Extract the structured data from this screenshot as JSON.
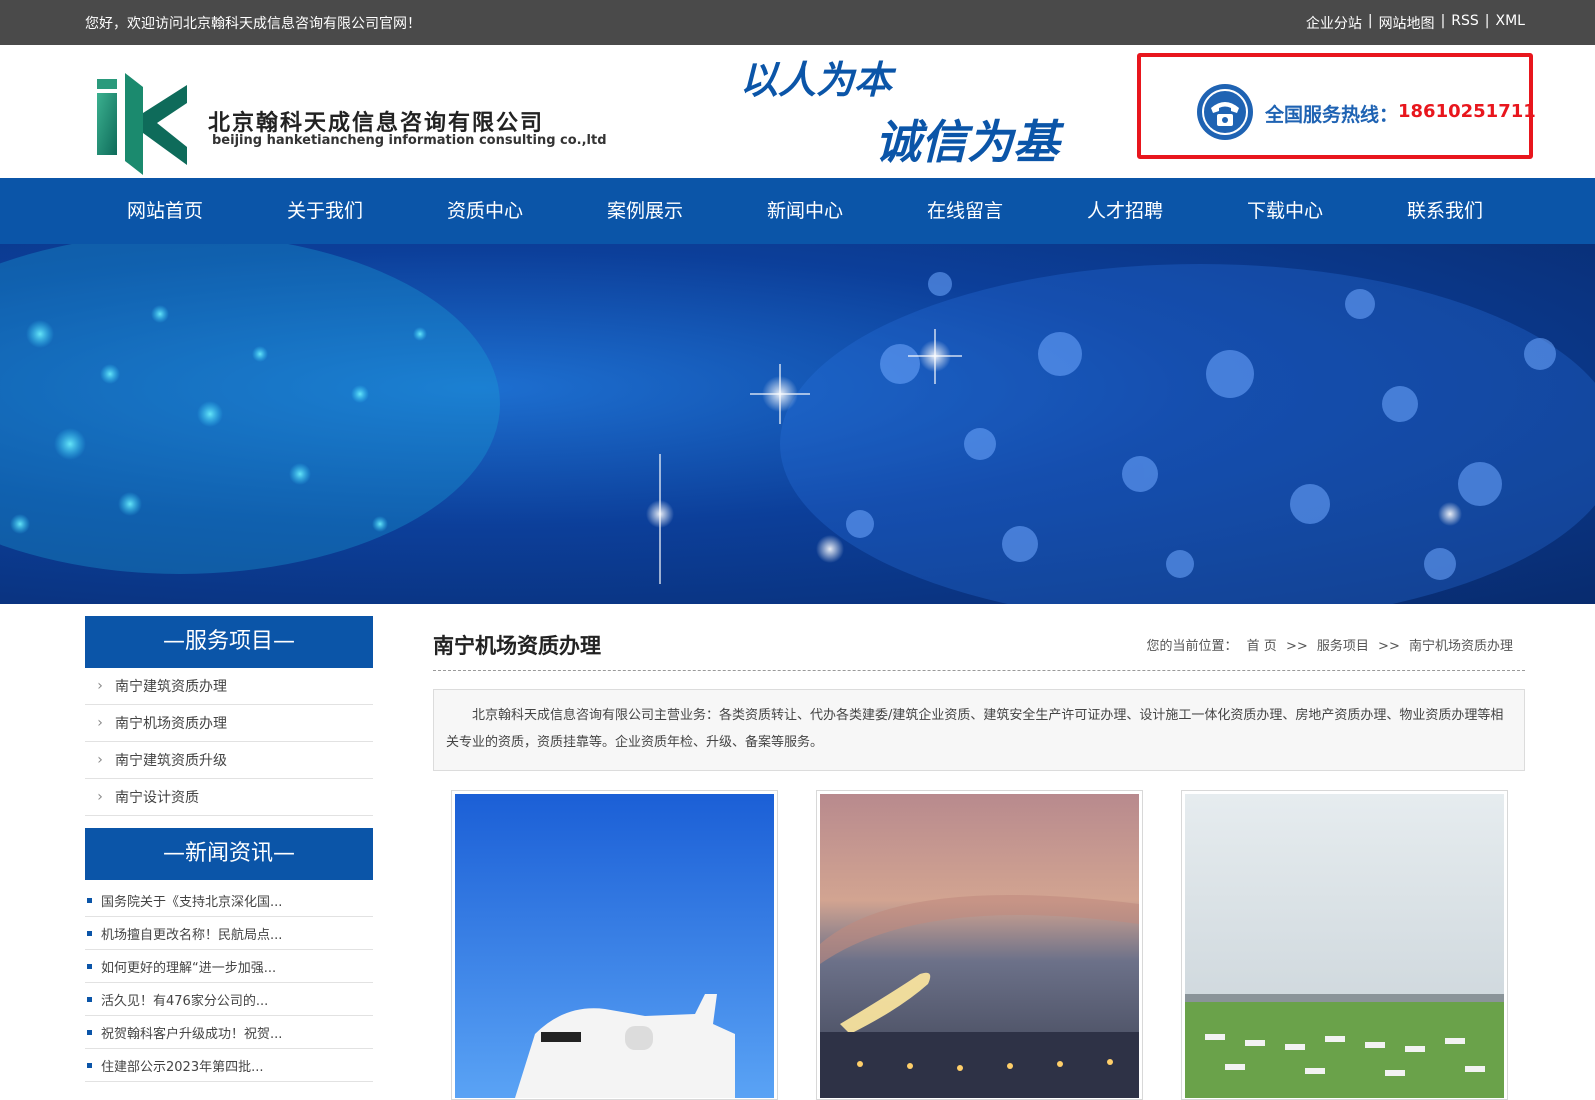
{
  "topbar": {
    "welcome": "您好，欢迎访问北京翰科天成信息咨询有限公司官网！",
    "links": [
      "企业分站",
      "网站地图",
      "RSS",
      "XML"
    ],
    "separator": "|"
  },
  "header": {
    "company_name": "北京翰科天成信息咨询有限公司",
    "company_en": "beijing hanketiancheng information consulting co.,ltd",
    "slogan_line1": "以人为本",
    "slogan_line2": "诚信为基",
    "hotline_label": "全国服务热线：",
    "hotline_number": "18610251711"
  },
  "nav": [
    "网站首页",
    "关于我们",
    "资质中心",
    "案例展示",
    "新闻中心",
    "在线留言",
    "人才招聘",
    "下载中心",
    "联系我们"
  ],
  "sidebar": {
    "services_title": "—服务项目—",
    "services": [
      "南宁建筑资质办理",
      "南宁机场资质办理",
      "南宁建筑资质升级",
      "南宁设计资质"
    ],
    "news_title": "—新闻资讯—",
    "news": [
      "国务院关于《支持北京深化国...",
      "机场擅自更改名称！民航局点...",
      "如何更好的理解“进一步加强...",
      "活久见！有476家分公司的...",
      "祝贺翰科客户升级成功！祝贺...",
      "住建部公示2023年第四批..."
    ]
  },
  "main": {
    "title": "南宁机场资质办理",
    "breadcrumb_label": "您的当前位置：",
    "breadcrumb": [
      "首 页",
      ">>",
      "服务项目",
      ">>",
      "南宁机场资质办理"
    ],
    "intro": "北京翰科天成信息咨询有限公司主营业务：各类资质转让、代办各类建委/建筑企业资质、建筑安全生产许可证办理、设计施工一体化资质办理、房地产资质办理、物业资质办理等相关专业的资质，资质挂靠等。企业资质年检、升级、备案等服务。"
  },
  "colors": {
    "primary_blue": "#0b55a8",
    "hotline_red": "#e8161d",
    "topbar_gray": "#4a4a4a"
  }
}
